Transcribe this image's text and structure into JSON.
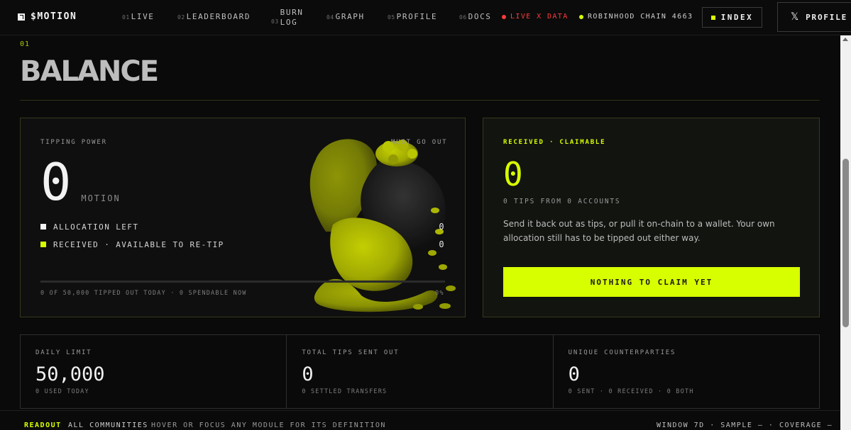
{
  "nav": {
    "brand": "$MOTION",
    "links": [
      {
        "num": "01",
        "label": "LIVE"
      },
      {
        "num": "02",
        "label": "LEADERBOARD"
      },
      {
        "num": "03",
        "label": "BURN LOG",
        "line1": "BURN",
        "line2": "LOG"
      },
      {
        "num": "04",
        "label": "GRAPH"
      },
      {
        "num": "05",
        "label": "PROFILE"
      },
      {
        "num": "06",
        "label": "DOCS"
      }
    ],
    "live_status": "LIVE X DATA",
    "chain_status": "ROBINHOOD CHAIN 4663",
    "index_button": "INDEX",
    "profile_button": "PROFILE"
  },
  "section": {
    "number": "01",
    "title": "BALANCE"
  },
  "tipping_card": {
    "label": "TIPPING POWER",
    "must_go_out": "MUST GO OUT",
    "value": "0",
    "unit": "MOTION",
    "legend": [
      {
        "label": "ALLOCATION LEFT",
        "value": "0",
        "color": "#f2f2f2"
      },
      {
        "label": "RECEIVED · AVAILABLE TO RE-TIP",
        "value": "0",
        "color": "#d8ff00"
      }
    ],
    "progress_fraction": 0,
    "footer": "0 OF 50,000 TIPPED OUT TODAY · 0 SPENDABLE NOW",
    "percent": "0%"
  },
  "claim_card": {
    "label": "RECEIVED · CLAIMABLE",
    "value": "0",
    "subtitle": "0 TIPS FROM 0 ACCOUNTS",
    "description": "Send it back out as tips, or pull it on-chain to a wallet. Your own allocation still has to be tipped out either way.",
    "button": "NOTHING TO CLAIM YET"
  },
  "stats": [
    {
      "label": "DAILY LIMIT",
      "value": "50,000",
      "sub": "0 USED TODAY"
    },
    {
      "label": "TOTAL TIPS SENT OUT",
      "value": "0",
      "sub": "0 SETTLED TRANSFERS"
    },
    {
      "label": "UNIQUE COUNTERPARTIES",
      "value": "0",
      "sub": "0 SENT · 0 RECEIVED · 0 BOTH"
    }
  ],
  "readout": {
    "title": "READOUT",
    "scope": "ALL COMMUNITIES",
    "hint": "HOVER OR FOCUS ANY MODULE FOR ITS DEFINITION",
    "meta": "WINDOW 7D · SAMPLE — · COVERAGE —"
  },
  "colors": {
    "accent": "#d8ff00",
    "live": "#ff3b3b",
    "background": "#0a0a0a"
  },
  "icons": {
    "x": "x-logo-icon",
    "index": "square-icon",
    "illustration": "money-bag-character-icon"
  }
}
